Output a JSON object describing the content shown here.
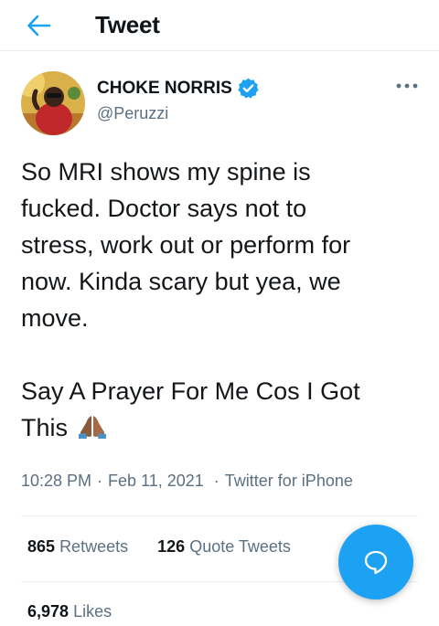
{
  "header": {
    "title": "Tweet",
    "back_icon": "arrow-left-icon",
    "accent": "#1da1f2"
  },
  "author": {
    "name": "CHOKE NORRIS",
    "handle": "@Peruzzi",
    "verified": true,
    "verified_color": "#1da1f2"
  },
  "tweet": {
    "lines": [
      "So MRI shows my spine is",
      "fucked. Doctor says not to",
      "stress, work out or perform for",
      "now. Kinda scary but yea, we",
      "move."
    ],
    "prayer_lines": [
      "Say A Prayer For Me Cos I Got",
      "This"
    ],
    "emoji": "folded-hands-icon",
    "time": "10:28 PM",
    "date": "Feb 11, 2021",
    "source": "Twitter for iPhone"
  },
  "stats": {
    "retweets_count": "865",
    "retweets_label": "Retweets",
    "quotes_count": "126",
    "quotes_label": "Quote Tweets",
    "likes_count": "6,978",
    "likes_label": "Likes"
  },
  "fab": {
    "icon": "compose-reply-icon",
    "color": "#1da1f2"
  }
}
